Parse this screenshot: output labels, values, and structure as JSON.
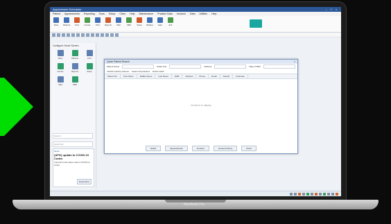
{
  "screen": {
    "app_title": "Appointment Scheduler",
    "window_buttons": [
      "–",
      "□",
      "×"
    ],
    "menu": [
      "Patient",
      "Appointments",
      "Reporting",
      "Tools",
      "Setup",
      "Clinic",
      "Help",
      "Maintenance",
      "Practice Data",
      "Invoices",
      "Data",
      "Utilities",
      "Help"
    ],
    "ribbon": [
      {
        "label": "Diary",
        "icon": "calendar-icon"
      },
      {
        "label": "Patients",
        "icon": "user-icon"
      },
      {
        "label": "Find",
        "icon": "search-icon"
      },
      {
        "label": "Invoice",
        "icon": "document-icon"
      },
      {
        "label": "Print",
        "icon": "print-icon"
      },
      {
        "label": "Reports",
        "icon": "chart-icon"
      },
      {
        "label": "Mail",
        "icon": "mail-icon"
      },
      {
        "label": "SMS",
        "icon": "message-icon"
      },
      {
        "label": "Setup",
        "icon": "gear-icon"
      },
      {
        "label": "Backup",
        "icon": "disk-icon"
      },
      {
        "label": "Help",
        "icon": "help-icon"
      },
      {
        "label": "Exit",
        "icon": "close-icon"
      }
    ],
    "left_panel": {
      "title": "Configure Home Screen",
      "tiles": [
        {
          "label": "Diary",
          "icon": "calendar-icon"
        },
        {
          "label": "Patients",
          "icon": "user-icon"
        },
        {
          "label": "Find",
          "icon": "search-icon"
        },
        {
          "label": "Invoice",
          "icon": "document-icon"
        },
        {
          "label": "Reports",
          "icon": "chart-icon"
        },
        {
          "label": "Setup",
          "icon": "gear-icon"
        },
        {
          "label": "Mail",
          "icon": "mail-icon"
        },
        {
          "label": "SMS",
          "icon": "message-icon"
        }
      ],
      "fields": [
        "Search...",
        "Quick find"
      ],
      "news": {
        "header": "News",
        "title": "(APG) update to COVID-19 Codes",
        "body": "Important information about COVID-19 codes.",
        "button": "Read More"
      }
    },
    "dialog": {
      "title": "Quick Patient Search",
      "close": "×",
      "fields": [
        "Patient Name",
        "Patient No",
        "Address",
        "Date of Birth"
      ],
      "options": [
        "Include inactive patients",
        "Search all practices",
        "Exact match"
      ],
      "columns": [
        "Patient No",
        "First Name",
        "Middle Name",
        "Last Name",
        "DOB",
        "Address",
        "Phone",
        "Email",
        "Suburb",
        "Postcode"
      ],
      "empty_text": "No items to display",
      "buttons": [
        "Select",
        "Appointments",
        "Invoices",
        "Account history",
        "Close"
      ]
    }
  },
  "base_label": "MacBook Pro",
  "colors": {
    "accent": "#2b5797",
    "arrow": "#00dd00",
    "teal": "#1aa7a1"
  }
}
